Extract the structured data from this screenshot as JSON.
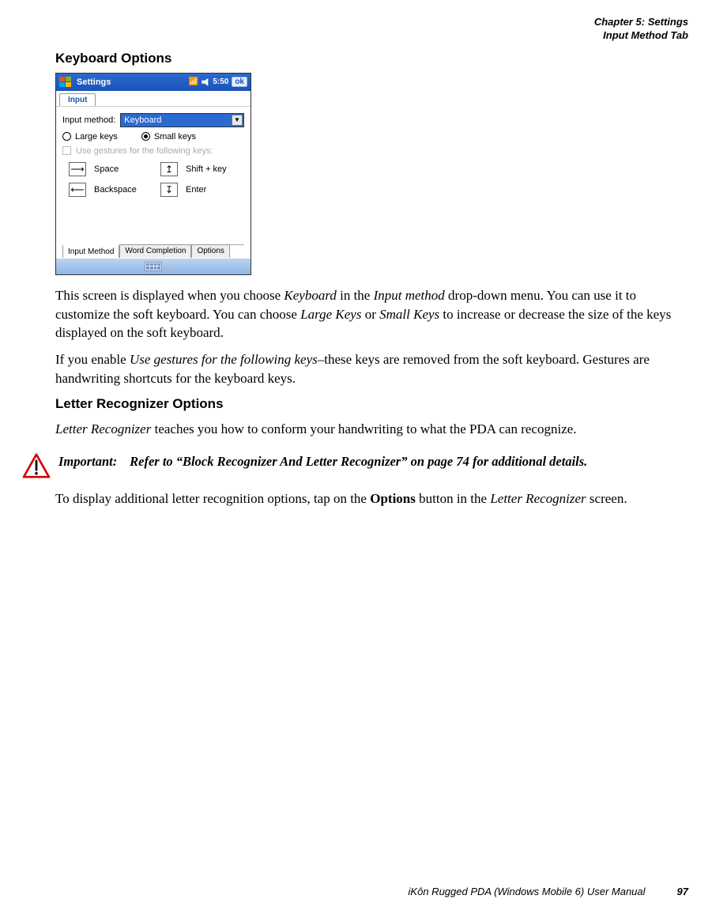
{
  "header": {
    "line1": "Chapter 5: Settings",
    "line2": "Input Method Tab"
  },
  "h_keyboard": "Keyboard Options",
  "device": {
    "title": "Settings",
    "time": "5:50",
    "ok": "ok",
    "app_tab": "Input",
    "input_method_label": "Input method:",
    "dropdown_value": "Keyboard",
    "large_keys": "Large keys",
    "small_keys": "Small keys",
    "gestures_cb": "Use gestures for the following keys:",
    "g_space": "Space",
    "g_shift": "Shift + key",
    "g_backspace": "Backspace",
    "g_enter": "Enter",
    "tab1": "Input Method",
    "tab2": "Word Completion",
    "tab3": "Options"
  },
  "p1a": "This screen is displayed when you choose ",
  "p1b": "Keyboard",
  "p1c": " in the ",
  "p1d": "Input method",
  "p1e": " drop-down menu. You can use it to customize the soft keyboard. You can choose ",
  "p1f": "Large Keys",
  "p1g": " or ",
  "p1h": "Small Keys",
  "p1i": " to increase or decrease the size of the keys displayed on the soft keyboard.",
  "p2a": "If you enable ",
  "p2b": "Use gestures for the following keys",
  "p2c": "–these keys are removed from the soft key­board. Gestures are handwriting shortcuts for the keyboard keys.",
  "h_letter": "Letter Recognizer Options",
  "p3a": "Letter Recognizer",
  "p3b": " teaches you how to conform your handwriting to what the PDA can recognize.",
  "important_label": "Important:",
  "important_text": "Refer to “Block Recognizer And Letter Recognizer” on page 74 for addi­tional details.",
  "p4a": "To display additional letter recognition options, tap on the ",
  "p4b": "Options",
  "p4c": " button in the ",
  "p4d": "Letter Rec­ognizer",
  "p4e": " screen.",
  "footer": {
    "title": "iKôn Rugged PDA (Windows Mobile 6) User Manual",
    "page": "97"
  }
}
